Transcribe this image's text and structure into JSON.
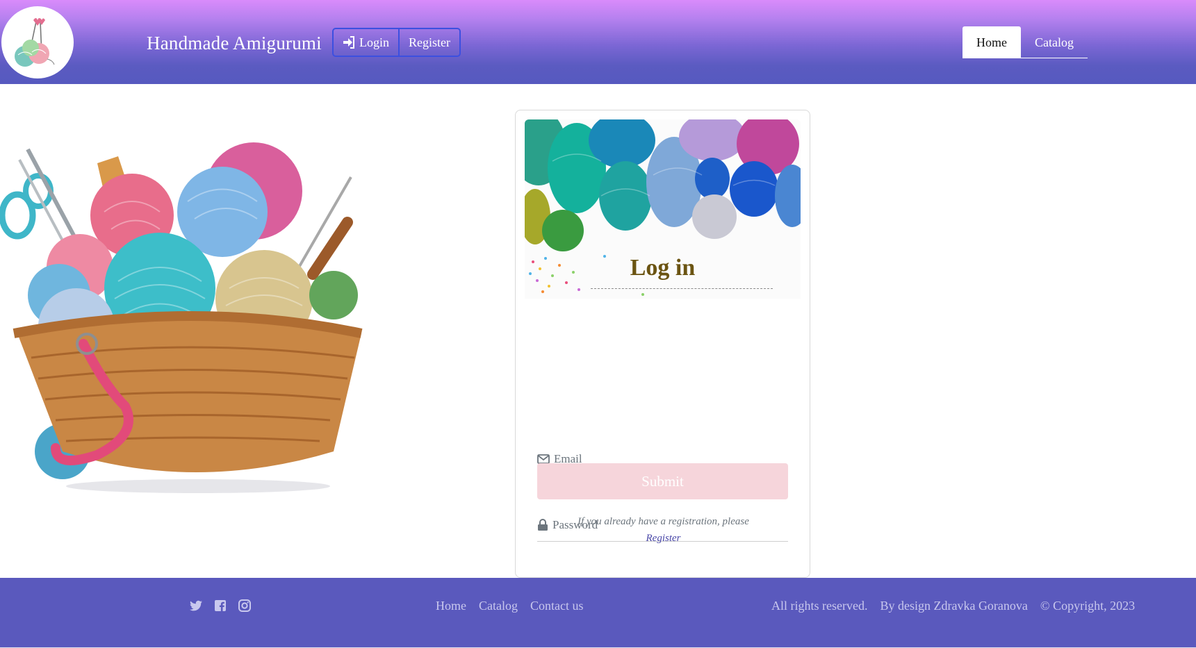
{
  "header": {
    "brand": "Handmade Amigurumi",
    "logo_icon": "yarn-balls-knitting-needles-logo",
    "auth": {
      "login_label": "Login",
      "login_icon": "sign-in-icon",
      "register_label": "Register"
    },
    "nav": [
      {
        "label": "Home",
        "active": true
      },
      {
        "label": "Catalog",
        "active": false
      }
    ]
  },
  "hero": {
    "image": "yarn-basket-illustration"
  },
  "login_card": {
    "banner_image": "colorful-yarn-balls-photo",
    "title": "Log in",
    "email_placeholder": "Email",
    "email_icon": "envelope-icon",
    "password_placeholder": "Password",
    "password_icon": "lock-icon",
    "submit_label": "Submit",
    "note_text": "If you already have a registration, please",
    "note_link": "Register"
  },
  "footer": {
    "social_icons": [
      "twitter-icon",
      "facebook-icon",
      "instagram-icon"
    ],
    "links": [
      "Home",
      "Catalog",
      "Contact us"
    ],
    "rights": "All rights reserved.",
    "designer": "By design Zdravka Goranova",
    "copyright": "© Copyright, 2023"
  },
  "colors": {
    "header_gradient_top": "#d98bfb",
    "header_gradient_bottom": "#5659bf",
    "footer_bg": "#5a59bd",
    "title_color": "#6b5412",
    "submit_bg": "#f6d5db",
    "auth_border": "#3c4fe0"
  }
}
